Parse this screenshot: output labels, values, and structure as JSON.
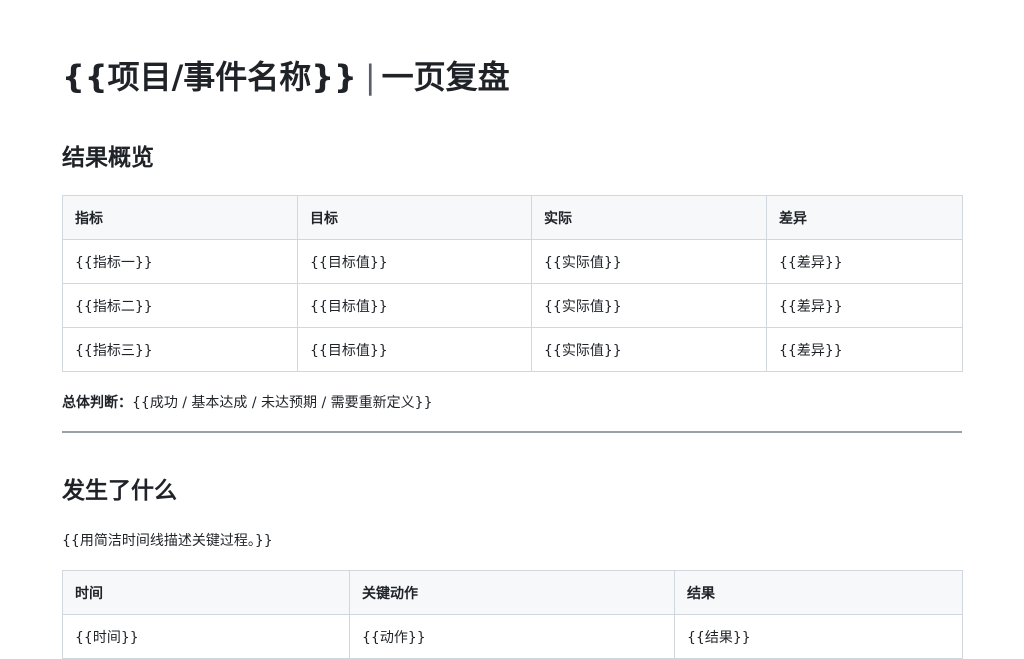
{
  "title": {
    "main": "{{项目/事件名称}}",
    "separator": "|",
    "sub": "一页复盘"
  },
  "overview": {
    "heading": "结果概览",
    "columns": [
      "指标",
      "目标",
      "实际",
      "差异"
    ],
    "rows": [
      [
        "{{指标一}}",
        "{{目标值}}",
        "{{实际值}}",
        "{{差异}}"
      ],
      [
        "{{指标二}}",
        "{{目标值}}",
        "{{实际值}}",
        "{{差异}}"
      ],
      [
        "{{指标三}}",
        "{{目标值}}",
        "{{实际值}}",
        "{{差异}}"
      ]
    ],
    "judgement_label": "总体判断：",
    "judgement_value": "{{成功 / 基本达成 / 未达预期 / 需要重新定义}}"
  },
  "what_happened": {
    "heading": "发生了什么",
    "description": "{{用简洁时间线描述关键过程。}}",
    "columns": [
      "时间",
      "关键动作",
      "结果"
    ],
    "rows": [
      [
        "{{时间}}",
        "{{动作}}",
        "{{结果}}"
      ]
    ]
  }
}
